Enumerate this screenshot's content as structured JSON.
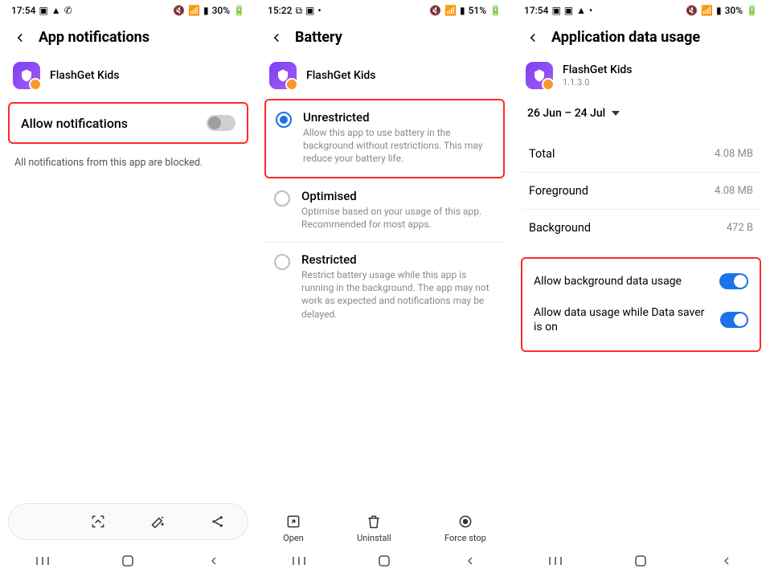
{
  "phone1": {
    "status": {
      "time": "17:54",
      "battery_pct": "30%"
    },
    "header": {
      "title": "App notifications"
    },
    "app": {
      "name": "FlashGet Kids"
    },
    "allow": {
      "label": "Allow notifications",
      "on": false
    },
    "note": "All notifications from this app are blocked."
  },
  "phone2": {
    "status": {
      "time": "15:22",
      "battery_pct": "51%"
    },
    "header": {
      "title": "Battery"
    },
    "app": {
      "name": "FlashGet Kids"
    },
    "options": [
      {
        "title": "Unrestricted",
        "desc": "Allow this app to use battery in the background without restrictions. This may reduce your battery life.",
        "selected": true
      },
      {
        "title": "Optimised",
        "desc": "Optimise based on your usage of this app. Recommended for most apps.",
        "selected": false
      },
      {
        "title": "Restricted",
        "desc": "Restrict battery usage while this app is running in the background. The app may not work as expected and notifications may be delayed.",
        "selected": false
      }
    ],
    "actions": {
      "open": "Open",
      "uninstall": "Uninstall",
      "forcestop": "Force stop"
    }
  },
  "phone3": {
    "status": {
      "time": "17:54",
      "battery_pct": "30%"
    },
    "header": {
      "title": "Application data usage"
    },
    "app": {
      "name": "FlashGet Kids",
      "version": "1.1.3.0"
    },
    "period": "26 Jun – 24 Jul",
    "usage": [
      {
        "k": "Total",
        "v": "4.08 MB"
      },
      {
        "k": "Foreground",
        "v": "4.08 MB"
      },
      {
        "k": "Background",
        "v": "472 B"
      }
    ],
    "switches": [
      {
        "label": "Allow background data usage",
        "on": true
      },
      {
        "label": "Allow data usage while Data saver is on",
        "on": true
      }
    ]
  }
}
